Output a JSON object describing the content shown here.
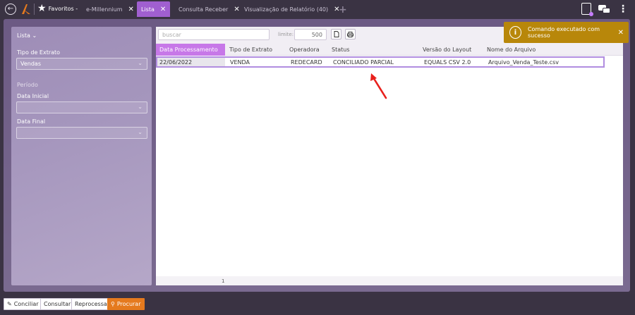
{
  "topbar": {
    "favorites_label": "Favoritos -",
    "tabs": [
      {
        "label": "e-Millennium",
        "active": false
      },
      {
        "label": "Lista",
        "active": true
      },
      {
        "label": "Consulta Receber",
        "active": false
      },
      {
        "label": "Visualização de Relatório (40)",
        "active": false
      }
    ],
    "accent_color": "#a05fd0"
  },
  "sidebar": {
    "title": "Lista",
    "tipo_extrato_label": "Tipo de Extrato",
    "tipo_extrato_value": "Vendas",
    "periodo_label": "Período",
    "data_inicial_label": "Data Inicial",
    "data_inicial_value": "",
    "data_final_label": "Data Final",
    "data_final_value": ""
  },
  "toolbar": {
    "search_placeholder": "buscar",
    "limit_label": "limite:",
    "limit_value": "500",
    "export_icon": "document-icon",
    "print_icon": "print-icon"
  },
  "table": {
    "columns": [
      "Data Processamento",
      "Tipo de Extrato",
      "Operadora",
      "Status",
      "Versão do Layout",
      "Nome do Arquivo"
    ],
    "rows": [
      [
        "22/06/2022",
        "VENDA",
        "REDECARD",
        "CONCILIADO PARCIAL",
        "EQUALS CSV 2.0",
        "Arquivo_Venda_Teste.csv"
      ]
    ],
    "page": "1"
  },
  "toast": {
    "message": "Comando executado com sucesso",
    "color": "#b8870a"
  },
  "actions": {
    "conciliar": "Conciliar",
    "consultar": "Consultar",
    "reprocessar": "Reprocessar",
    "procurar": "Procurar"
  }
}
